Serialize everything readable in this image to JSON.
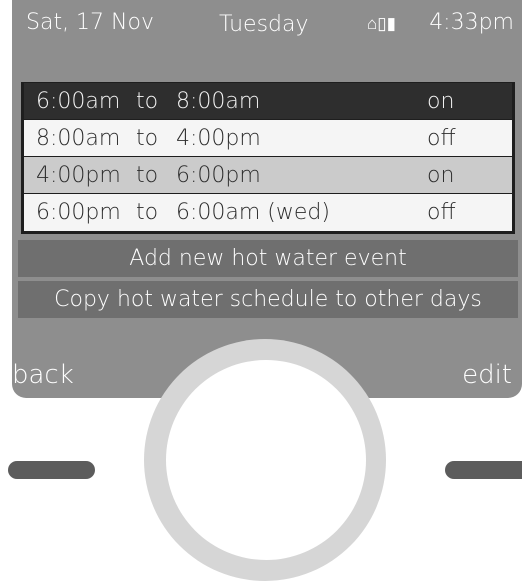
{
  "status_bar": {
    "date": "Sat, 17 Nov",
    "day": "Tuesday",
    "icons": "⌂▯▮",
    "time": "4:33pm"
  },
  "schedule": {
    "rows": [
      {
        "from": "6:00am",
        "to": "to",
        "until": "8:00am",
        "state": "on"
      },
      {
        "from": "8:00am",
        "to": "to",
        "until": "4:00pm",
        "state": "off"
      },
      {
        "from": "4:00pm",
        "to": "to",
        "until": "6:00pm",
        "state": "on"
      },
      {
        "from": "6:00pm",
        "to": "to",
        "until": "6:00am (wed)",
        "state": "off"
      }
    ]
  },
  "menu": {
    "add_event": "Add new hot water event",
    "copy_schedule": "Copy hot water schedule to other days"
  },
  "softkeys": {
    "back": "back",
    "edit": "edit"
  }
}
